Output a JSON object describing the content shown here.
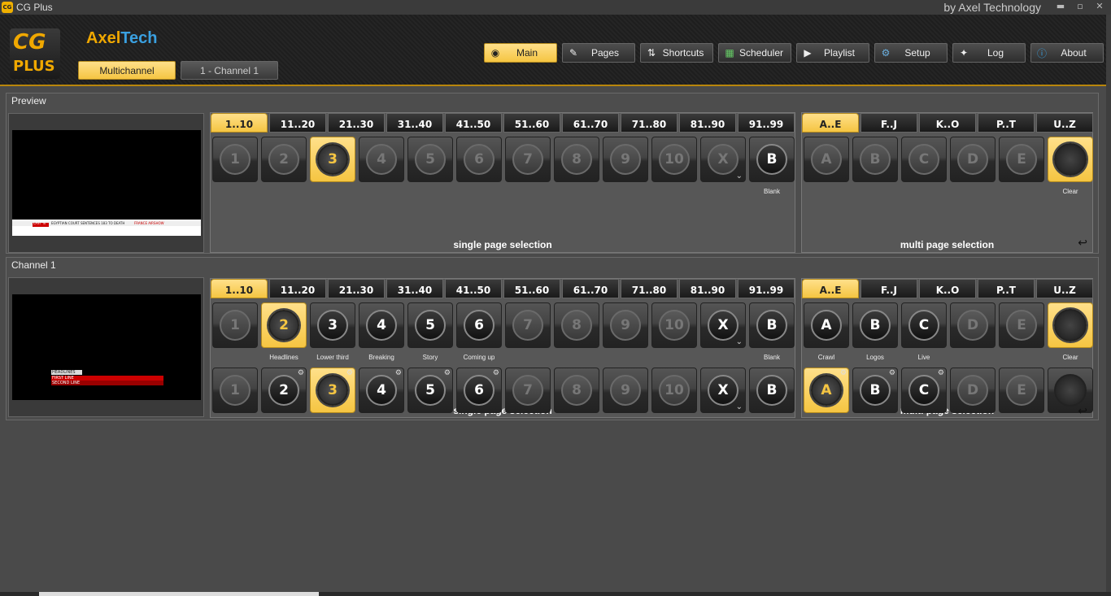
{
  "app": {
    "title": "CG Plus",
    "icon_text": "CG",
    "byline": "by Axel Technology"
  },
  "window_controls": {
    "minimize": "▬",
    "restore": "▫",
    "close": "✕"
  },
  "logo": {
    "cg": "CG",
    "plus": "PLUS",
    "axel_a": "Axel",
    "axel_b": "Tech"
  },
  "header_tabs": [
    {
      "label": "Multichannel",
      "active": true
    },
    {
      "label": "1 - Channel 1",
      "active": false
    }
  ],
  "nav": [
    {
      "label": "Main",
      "icon": "mouse-icon",
      "active": true
    },
    {
      "label": "Pages",
      "icon": "pencil-icon",
      "active": false
    },
    {
      "label": "Shortcuts",
      "icon": "arrows-icon",
      "active": false
    },
    {
      "label": "Scheduler",
      "icon": "grid-icon",
      "active": false
    },
    {
      "label": "Playlist",
      "icon": "play-icon",
      "active": false
    },
    {
      "label": "Setup",
      "icon": "gear-icon",
      "active": false
    },
    {
      "label": "Log",
      "icon": "log-icon",
      "active": false
    },
    {
      "label": "About",
      "icon": "info-icon",
      "active": false
    }
  ],
  "preview": {
    "title": "Preview",
    "ticker_label": "LAST %",
    "ticker_text": "EGYPTIAN COURT SENTENCES 183 TO DEATH",
    "ticker_text2": "FRANCE AIRSHOW",
    "page_tabs": [
      "1..10",
      "11..20",
      "21..30",
      "31..40",
      "41..50",
      "51..60",
      "61..70",
      "71..80",
      "81..90",
      "91..99"
    ],
    "multi_tabs": [
      "A..E",
      "F..J",
      "K..O",
      "P..T",
      "U..Z"
    ],
    "single_keys": [
      "1",
      "2",
      "3",
      "4",
      "5",
      "6",
      "7",
      "8",
      "9",
      "10",
      "X",
      "B"
    ],
    "single_labels": [
      "",
      "",
      "",
      "",
      "",
      "",
      "",
      "",
      "",
      "",
      "",
      "Blank"
    ],
    "multi_keys": [
      "A",
      "B",
      "C",
      "D",
      "E",
      ""
    ],
    "multi_labels": [
      "",
      "",
      "",
      "",
      "",
      "Clear"
    ],
    "single_title": "single page selection",
    "multi_title": "multi page selection"
  },
  "channel": {
    "title": "Channel 1",
    "lower_third": {
      "line0": "HEADLINES",
      "line1": "FIRST LINE",
      "line2": "SECOND LINE"
    },
    "page_tabs": [
      "1..10",
      "11..20",
      "21..30",
      "31..40",
      "41..50",
      "51..60",
      "61..70",
      "71..80",
      "81..90",
      "91..99"
    ],
    "multi_tabs": [
      "A..E",
      "F..J",
      "K..O",
      "P..T",
      "U..Z"
    ],
    "row1_keys": [
      "1",
      "2",
      "3",
      "4",
      "5",
      "6",
      "7",
      "8",
      "9",
      "10",
      "X",
      "B"
    ],
    "row1_labels": [
      "",
      "Headlines",
      "Lower third",
      "Breaking",
      "Story",
      "Coming up",
      "",
      "",
      "",
      "",
      "",
      "Blank"
    ],
    "row2_keys": [
      "1",
      "2",
      "3",
      "4",
      "5",
      "6",
      "7",
      "8",
      "9",
      "10",
      "X",
      "B"
    ],
    "multi_row1": [
      "A",
      "B",
      "C",
      "D",
      "E",
      ""
    ],
    "multi_row1_labels": [
      "Crawl",
      "Logos",
      "Live",
      "",
      "",
      "Clear"
    ],
    "multi_row2": [
      "A",
      "B",
      "C",
      "D",
      "E",
      ""
    ],
    "single_title": "single page selection",
    "multi_title": "multi page selection"
  }
}
